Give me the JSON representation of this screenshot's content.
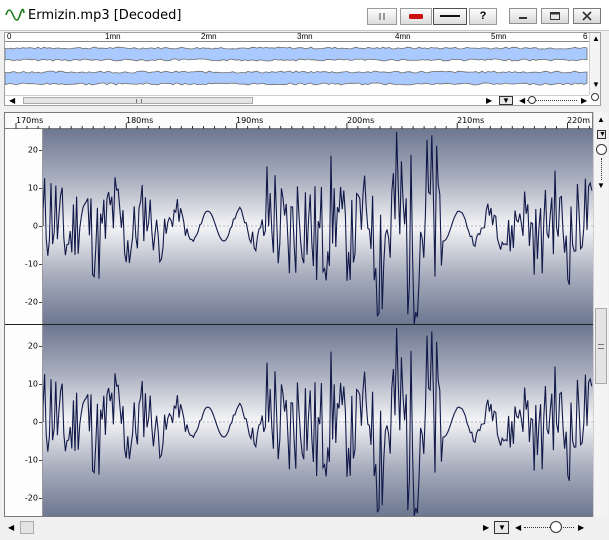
{
  "window": {
    "title": "Ermizin.mp3 [Decoded]"
  },
  "toolbar": {
    "buttons": [
      {
        "name": "pause-button",
        "icon": "pause-icon"
      },
      {
        "name": "record-button",
        "icon": "record-icon",
        "color": "#cc1111"
      },
      {
        "name": "line-tool-button",
        "icon": "line-icon"
      },
      {
        "name": "help-button",
        "label": "?"
      }
    ]
  },
  "window_controls": {
    "minimize": "minimize-icon",
    "maximize": "maximize-icon",
    "close": "close-icon"
  },
  "overview": {
    "ruler_ticks": [
      "0",
      "1mn",
      "2mn",
      "3mn",
      "4mn",
      "5mn",
      "6"
    ],
    "fill_color": "#a9c9ff",
    "outline_color": "#6e6e6e"
  },
  "main": {
    "ruler_ticks": [
      "170ms",
      "180ms",
      "190ms",
      "200ms",
      "210ms",
      "220m"
    ],
    "channels": [
      {
        "y_ticks": [
          "20",
          "10",
          "0",
          "-10",
          "-20"
        ]
      },
      {
        "y_ticks": [
          "20",
          "10",
          "0",
          "-10",
          "-20"
        ]
      }
    ],
    "wave_color": "#121a4a"
  }
}
